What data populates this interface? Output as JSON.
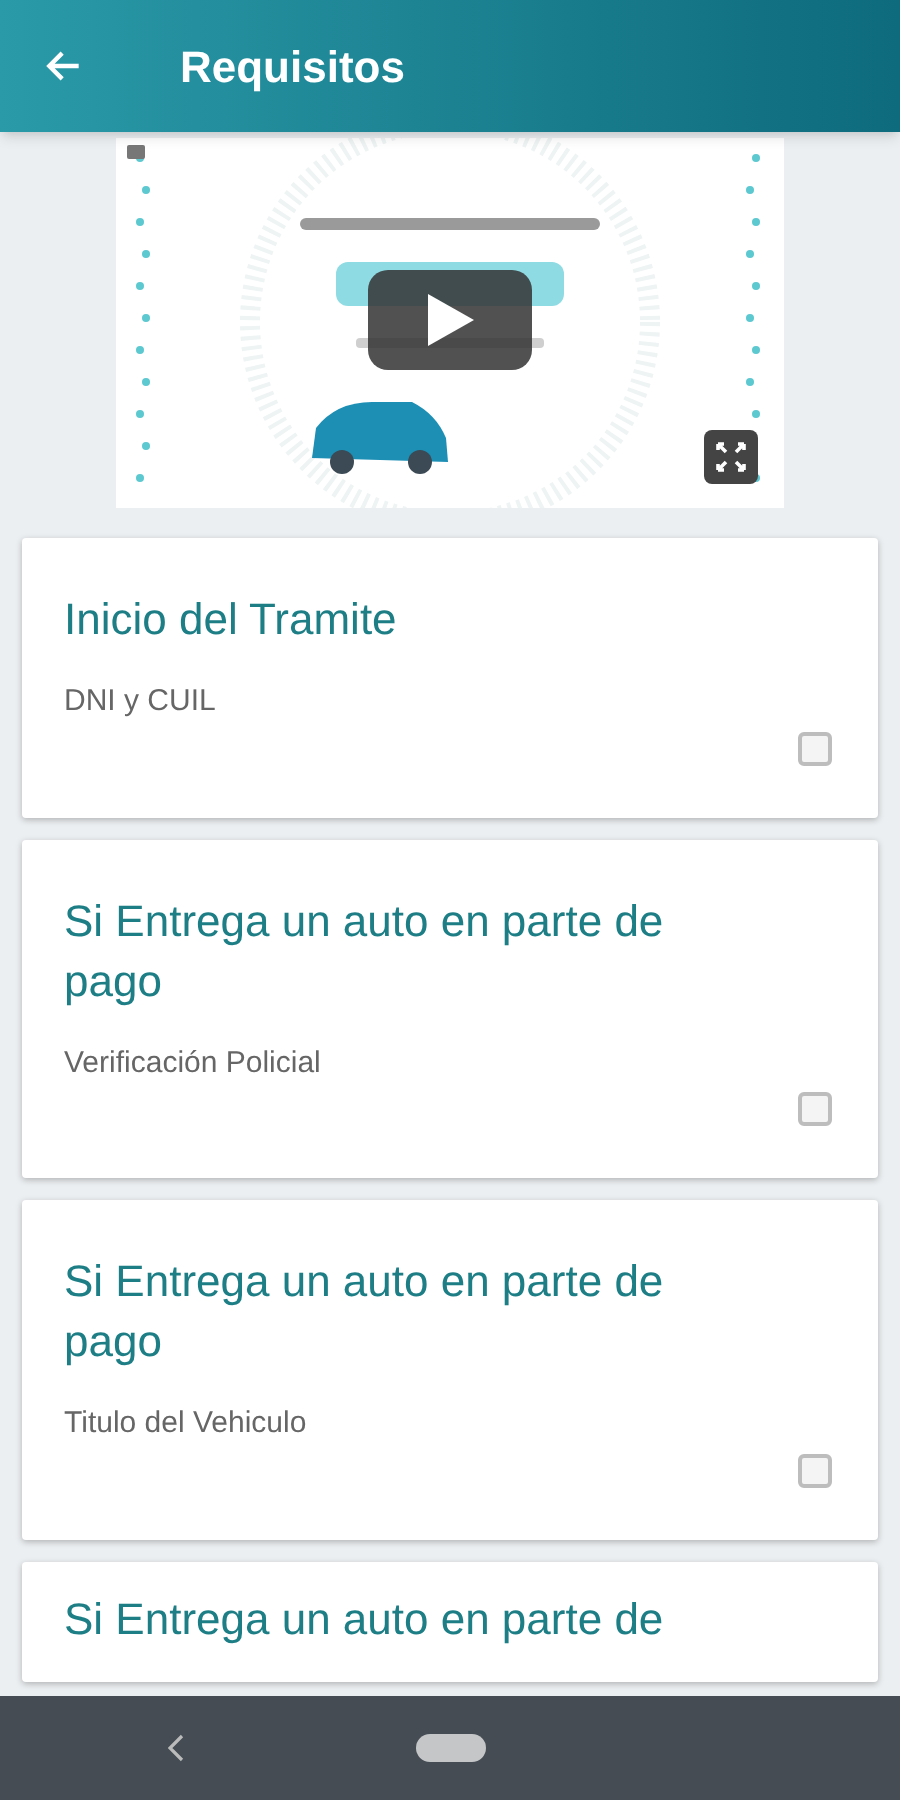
{
  "app_bar": {
    "title": "Requisitos"
  },
  "requirements": [
    {
      "title": "Inicio del Tramite",
      "detail": "DNI y CUIL",
      "checked": false
    },
    {
      "title": "Si Entrega un auto en parte de pago",
      "detail": "Verificación Policial",
      "checked": false
    },
    {
      "title": "Si Entrega un auto en parte de pago",
      "detail": "Titulo del Vehiculo",
      "checked": false
    },
    {
      "title": "Si Entrega un auto en parte de"
    }
  ]
}
